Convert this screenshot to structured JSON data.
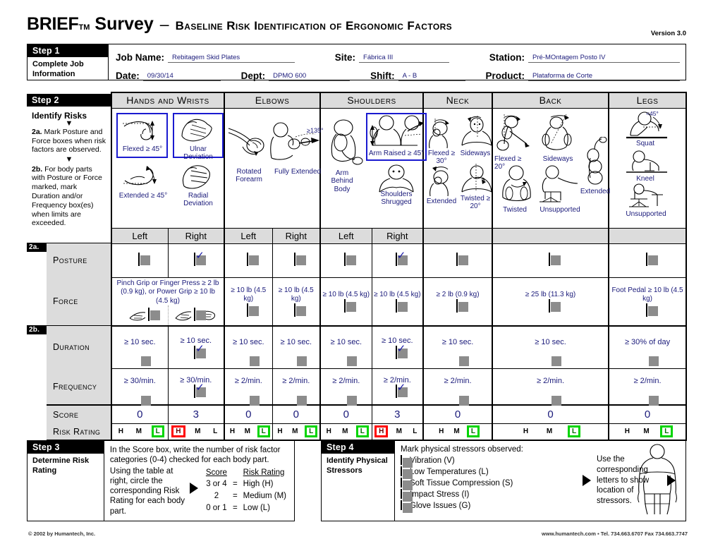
{
  "header": {
    "brand": "BRIEF",
    "tm": "TM",
    "survey": "Survey",
    "dash": "–",
    "subtitle": "Baseline Risk Identification of Ergonomic Factors",
    "version": "Version 3.0"
  },
  "step1": {
    "step_label": "Step 1",
    "step_title": "Complete Job Information",
    "fields": [
      {
        "label": "Job Name:",
        "value": "Rebitagem Skid Plates"
      },
      {
        "label": "Site:",
        "value": "Fábrica III"
      },
      {
        "label": "Station:",
        "value": "Pré-MOntagem Posto IV"
      },
      {
        "label": "Date:",
        "value": "09/30/14"
      },
      {
        "label": "Dept:",
        "value": "DPMO 600"
      },
      {
        "label": "Shift:",
        "value": "A - B"
      },
      {
        "label": "Product:",
        "value": "Plataforma de Corte"
      }
    ]
  },
  "step2": {
    "step_label": "Step 2",
    "identify_risks": "Identify Risks",
    "instr_2a_bold": "2a.",
    "instr_2a": " Mark Posture and Force boxes when risk factors are observed.",
    "instr_2b_bold": "2b.",
    "instr_2b": " For body parts with Posture or Force marked, mark Duration and/or Frequency box(es) when limits are exceeded.",
    "tag_2a": "2a.",
    "tag_2b": "2b.",
    "body_parts": [
      "Hands and Wrists",
      "Elbows",
      "Shoulders",
      "Neck",
      "Back",
      "Legs"
    ],
    "side_left": "Left",
    "side_right": "Right",
    "figure_labels": {
      "hands": [
        "Flexed ≥ 45°",
        "Ulnar Deviation",
        "Extended ≥ 45°",
        "Radial Deviation"
      ],
      "elbows": [
        "Rotated Forearm",
        "Fully Extended",
        "≥135°"
      ],
      "shoulders": [
        "Arm Behind Body",
        "Arm Raised ≥ 45°",
        "Shoulders Shrugged"
      ],
      "neck": [
        "Flexed ≥ 30°",
        "Sideways",
        "Extended",
        "Twisted ≥ 20°"
      ],
      "back": [
        "Flexed ≥ 20°",
        "Sideways",
        "Twisted",
        "Unsupported",
        "Extended"
      ],
      "legs": [
        "<45°",
        "Squat",
        "Kneel",
        "Unsupported"
      ]
    },
    "rows": {
      "posture": "Posture",
      "force": "Force",
      "duration": "Duration",
      "frequency": "Frequency",
      "score": "Score",
      "risk_rating": "Risk Rating"
    },
    "posture_checked": [
      false,
      true,
      false,
      false,
      false,
      true,
      false,
      false,
      false
    ],
    "force_labels": [
      "Pinch Grip or Finger Press ≥ 2 lb (0.9 kg), or Power Grip ≥ 10 lb (4.5 kg)",
      "Pinch Grip or Finger Press ≥ 2 lb (0.9 kg), or Power Grip ≥ 10 lb (4.5 kg)",
      "≥ 10 lb (4.5 kg)",
      "≥ 10 lb (4.5 kg)",
      "≥ 10 lb (4.5 kg)",
      "≥ 10 lb (4.5 kg)",
      "≥ 2 lb (0.9 kg)",
      "≥ 25 lb (11.3 kg)",
      "Foot Pedal ≥ 10 lb (4.5 kg)"
    ],
    "force_checked": [
      false,
      false,
      false,
      false,
      false,
      false,
      false,
      false,
      false
    ],
    "duration_labels": [
      "≥ 10 sec.",
      "≥ 10 sec.",
      "≥ 10 sec.",
      "≥ 10 sec.",
      "≥ 10 sec.",
      "≥ 10 sec.",
      "≥ 10 sec.",
      "≥ 10 sec.",
      "≥ 30% of day"
    ],
    "duration_checked": [
      false,
      true,
      false,
      false,
      false,
      true,
      false,
      false,
      false
    ],
    "frequency_labels": [
      "≥ 30/min.",
      "≥ 30/min.",
      "≥ 2/min.",
      "≥ 2/min.",
      "≥ 2/min.",
      "≥ 2/min.",
      "≥ 2/min.",
      "≥ 2/min.",
      "≥ 2/min."
    ],
    "frequency_checked": [
      false,
      true,
      false,
      false,
      false,
      true,
      false,
      false,
      false
    ],
    "scores": [
      "0",
      "3",
      "0",
      "0",
      "0",
      "3",
      "0",
      "0",
      "0"
    ],
    "risk_letters": [
      "H",
      "M",
      "L"
    ],
    "risk_selected": [
      "L",
      "H",
      "L",
      "L",
      "L",
      "H",
      "L",
      "L",
      "L"
    ]
  },
  "step3": {
    "step_label": "Step 3",
    "step_title": "Determine Risk Rating",
    "text1": "In the Score box, write the number of risk factor categories (0-4) checked for each body part.",
    "text2": "Using the table at right, circle the corresponding Risk Rating for each body part.",
    "table_head": [
      "Score",
      "Risk Rating"
    ],
    "table_rows": [
      {
        "score": "3 or 4",
        "eq": "=",
        "rating": "High (H)"
      },
      {
        "score": "2",
        "eq": "=",
        "rating": "Medium (M)"
      },
      {
        "score": "0 or 1",
        "eq": "=",
        "rating": "Low (L)"
      }
    ]
  },
  "step4": {
    "step_label": "Step 4",
    "step_title": "Identify Physical Stressors",
    "prompt": "Mark physical stressors observed:",
    "stressors": [
      {
        "label": "Vibration (V)",
        "checked": false
      },
      {
        "label": "Low Temperatures (L)",
        "checked": false
      },
      {
        "label": "Soft Tissue Compression (S)",
        "checked": false
      },
      {
        "label": "Impact Stress (I)",
        "checked": false
      },
      {
        "label": "Glove Issues (G)",
        "checked": false
      }
    ],
    "note": "Use the corresponding letters to show location of stressors."
  },
  "footer": {
    "copyright": "© 2002 by Humantech, Inc.",
    "contact": "www.humantech.com  ▪  Tel. 734.663.6707   Fax 734.663.7747"
  },
  "colors": {
    "high": "#ff0000",
    "low": "#00d400",
    "ink": "#1a1a7a",
    "header_bg": "#dcdcdc"
  }
}
